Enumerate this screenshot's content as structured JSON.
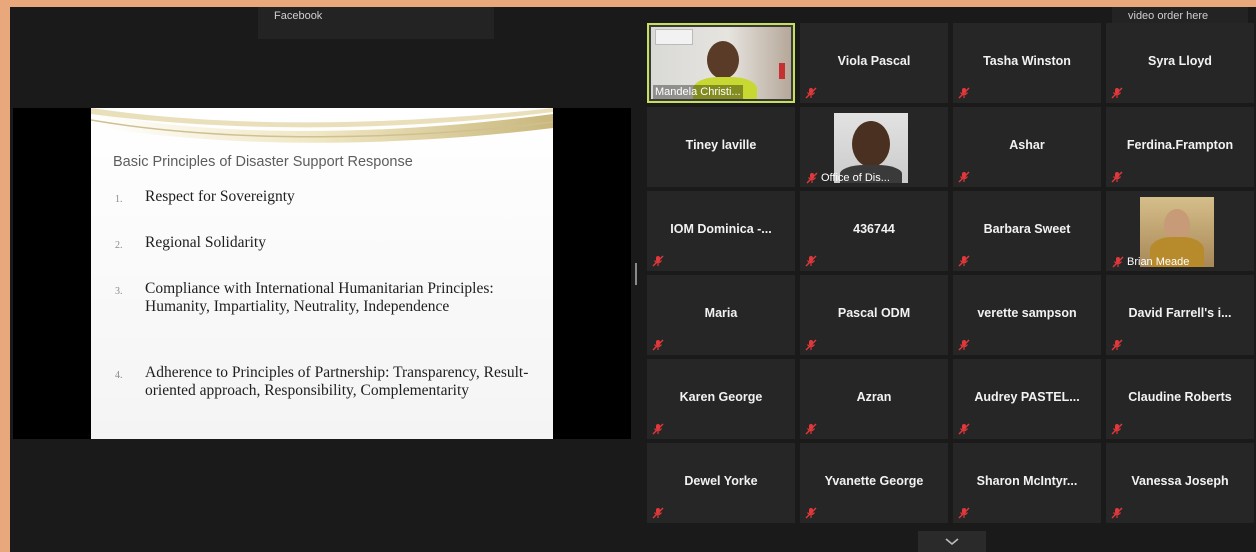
{
  "notifications": {
    "left": "Facebook",
    "right": "video order here"
  },
  "slide": {
    "title": "Basic Principles of Disaster Support Response",
    "items": [
      {
        "num": "1.",
        "text": "Respect for Sovereignty"
      },
      {
        "num": "2.",
        "text": "Regional Solidarity"
      },
      {
        "num": "3.",
        "text": "Compliance with International Humanitarian Principles: Humanity, Impartiality, Neutrality, Independence"
      },
      {
        "num": "4.",
        "text": "Adherence to Principles of Partnership: Transparency, Result-oriented approach, Responsibility, Complementarity"
      }
    ]
  },
  "participants": [
    {
      "name": "Mandela Christi...",
      "video": true,
      "active": true,
      "muted": false
    },
    {
      "name": "Viola Pascal",
      "video": false,
      "muted": true
    },
    {
      "name": "Tasha Winston",
      "video": false,
      "muted": true
    },
    {
      "name": "Syra Lloyd",
      "video": false,
      "muted": true
    },
    {
      "name": "Tiney laville",
      "video": false,
      "muted": false
    },
    {
      "name": "Office of Dis...",
      "video": true,
      "muted": true
    },
    {
      "name": "Ashar",
      "video": false,
      "muted": true
    },
    {
      "name": "Ferdina.Frampton",
      "video": false,
      "muted": true
    },
    {
      "name": "IOM Dominica -...",
      "video": false,
      "muted": true
    },
    {
      "name": "436744",
      "video": false,
      "muted": true
    },
    {
      "name": "Barbara Sweet",
      "video": false,
      "muted": true
    },
    {
      "name": "Brian Meade",
      "video": true,
      "muted": true
    },
    {
      "name": "Maria",
      "video": false,
      "muted": true
    },
    {
      "name": "Pascal ODM",
      "video": false,
      "muted": true
    },
    {
      "name": "verette sampson",
      "video": false,
      "muted": true
    },
    {
      "name": "David Farrell's i...",
      "video": false,
      "muted": true
    },
    {
      "name": "Karen George",
      "video": false,
      "muted": true
    },
    {
      "name": "Azran",
      "video": false,
      "muted": true
    },
    {
      "name": "Audrey PASTEL...",
      "video": false,
      "muted": true
    },
    {
      "name": "Claudine Roberts",
      "video": false,
      "muted": true
    },
    {
      "name": "Dewel Yorke",
      "video": false,
      "muted": true
    },
    {
      "name": "Yvanette George",
      "video": false,
      "muted": true
    },
    {
      "name": "Sharon McIntyr...",
      "video": false,
      "muted": true
    },
    {
      "name": "Vanessa Joseph",
      "video": false,
      "muted": true
    }
  ],
  "colors": {
    "frame": "#e8a87c",
    "background": "#1a1a1a",
    "tile": "#262626",
    "active_border": "#c7e05a",
    "muted_icon": "#e0383b"
  },
  "icons": {
    "muted": "mic-muted-icon",
    "gallery_next": "chevron-down-icon"
  }
}
